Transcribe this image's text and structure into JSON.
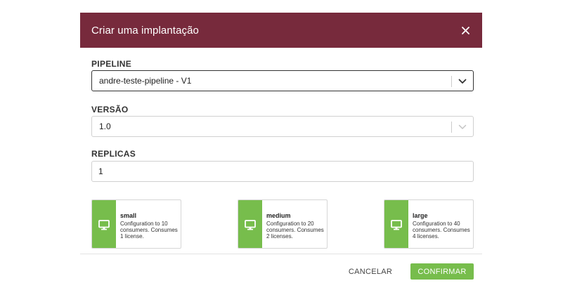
{
  "colors": {
    "header_bg": "#772a3c",
    "accent_green": "#77bd4c",
    "focus_border": "#333333",
    "border": "#d0d0d0"
  },
  "modal": {
    "title": "Criar uma implantação",
    "close_icon": "close-icon"
  },
  "pipeline": {
    "label": "PIPELINE",
    "value": "andre-teste-pipeline - V1",
    "icon": "chevron-down-icon"
  },
  "version": {
    "label": "VERSÃO",
    "value": "1.0",
    "icon": "chevron-down-icon"
  },
  "replicas": {
    "label": "REPLICAS",
    "value": "1"
  },
  "configs": [
    {
      "name": "small",
      "description": "Configuration to 10 consumers. Consumes 1 license.",
      "icon": "monitor-icon"
    },
    {
      "name": "medium",
      "description": "Configuration to 20 consumers. Consumes 2 licenses.",
      "icon": "monitor-icon"
    },
    {
      "name": "large",
      "description": "Configuration to 40 consumers. Consumes 4 licenses.",
      "icon": "monitor-icon"
    }
  ],
  "footer": {
    "cancel_label": "CANCELAR",
    "confirm_label": "CONFIRMAR"
  }
}
